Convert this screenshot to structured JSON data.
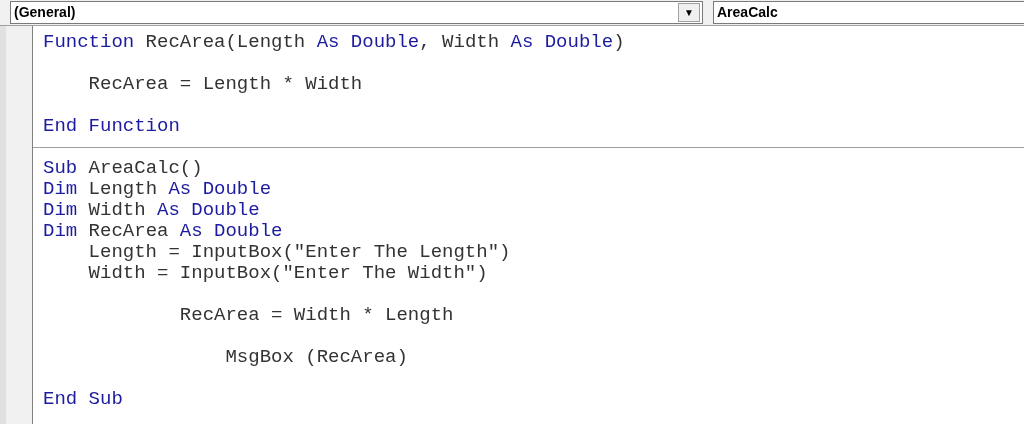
{
  "object_box": {
    "value": "(General)",
    "arrow": "▼"
  },
  "procedure_box": {
    "value": "AreaCalc"
  },
  "procedures": [
    {
      "lines": [
        {
          "kind": "code",
          "tokens": [
            {
              "kind": "keyword",
              "text": "Function"
            },
            {
              "kind": "plain",
              "text": " RecArea(Length "
            },
            {
              "kind": "keyword",
              "text": "As Double"
            },
            {
              "kind": "plain",
              "text": ", Width "
            },
            {
              "kind": "keyword",
              "text": "As Double"
            },
            {
              "kind": "plain",
              "text": ")"
            }
          ]
        },
        {
          "kind": "blank"
        },
        {
          "kind": "code",
          "tokens": [
            {
              "kind": "plain",
              "text": "    RecArea = Length * Width"
            }
          ]
        },
        {
          "kind": "blank"
        },
        {
          "kind": "code",
          "tokens": [
            {
              "kind": "keyword",
              "text": "End Function"
            }
          ]
        }
      ]
    },
    {
      "lines": [
        {
          "kind": "code",
          "tokens": [
            {
              "kind": "keyword",
              "text": "Sub"
            },
            {
              "kind": "plain",
              "text": " AreaCalc()"
            }
          ]
        },
        {
          "kind": "code",
          "tokens": [
            {
              "kind": "keyword",
              "text": "Dim"
            },
            {
              "kind": "plain",
              "text": " Length "
            },
            {
              "kind": "keyword",
              "text": "As Double"
            }
          ]
        },
        {
          "kind": "code",
          "tokens": [
            {
              "kind": "keyword",
              "text": "Dim"
            },
            {
              "kind": "plain",
              "text": " Width "
            },
            {
              "kind": "keyword",
              "text": "As Double"
            }
          ]
        },
        {
          "kind": "code",
          "tokens": [
            {
              "kind": "keyword",
              "text": "Dim"
            },
            {
              "kind": "plain",
              "text": " RecArea "
            },
            {
              "kind": "keyword",
              "text": "As Double"
            }
          ]
        },
        {
          "kind": "code",
          "tokens": [
            {
              "kind": "plain",
              "text": "    Length = InputBox(\"Enter The Length\")"
            }
          ]
        },
        {
          "kind": "code",
          "tokens": [
            {
              "kind": "plain",
              "text": "    Width = InputBox(\"Enter The Width\")"
            }
          ]
        },
        {
          "kind": "blank"
        },
        {
          "kind": "code",
          "tokens": [
            {
              "kind": "plain",
              "text": "            RecArea = Width * Length"
            }
          ]
        },
        {
          "kind": "blank"
        },
        {
          "kind": "code",
          "tokens": [
            {
              "kind": "plain",
              "text": "                MsgBox (RecArea)"
            }
          ]
        },
        {
          "kind": "blank"
        },
        {
          "kind": "code",
          "tokens": [
            {
              "kind": "keyword",
              "text": "End Sub"
            }
          ]
        }
      ]
    }
  ]
}
